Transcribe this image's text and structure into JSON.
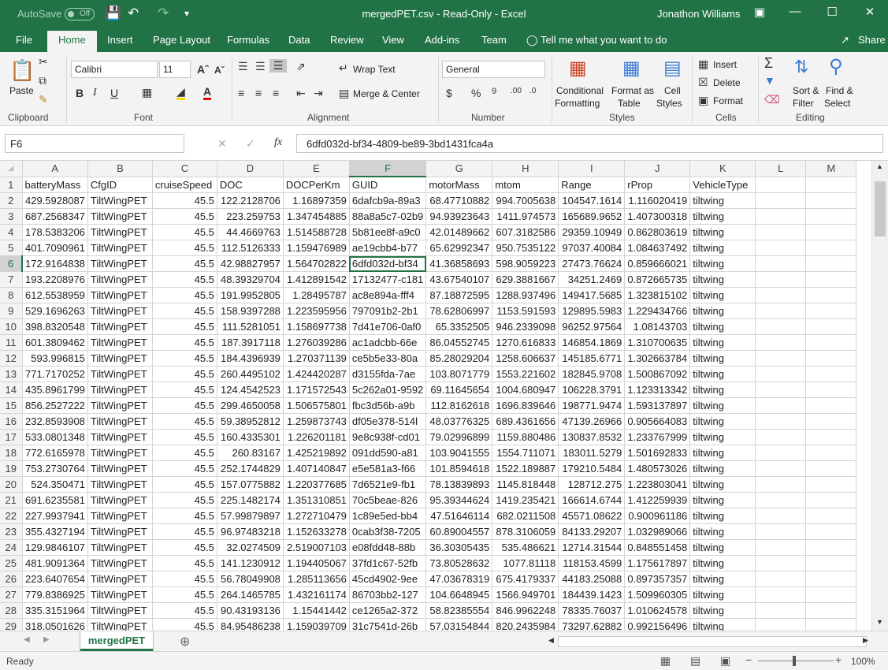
{
  "titlebar": {
    "autosave_label": "AutoSave",
    "autosave_state": "Off",
    "title": "mergedPET.csv  -  Read-Only  -  Excel",
    "user": "Jonathon Williams"
  },
  "tabs": [
    "File",
    "Home",
    "Insert",
    "Page Layout",
    "Formulas",
    "Data",
    "Review",
    "View",
    "Add-ins",
    "Team"
  ],
  "tell_me": "Tell me what you want to do",
  "share": "Share",
  "ribbon": {
    "paste": "Paste",
    "font_name": "Calibri",
    "font_size": "11",
    "wrap_text": "Wrap Text",
    "merge_center": "Merge & Center",
    "number_format": "General",
    "conditional": [
      "Conditional",
      "Formatting"
    ],
    "format_table": [
      "Format as",
      "Table"
    ],
    "cell_styles": [
      "Cell",
      "Styles"
    ],
    "insert": "Insert",
    "delete": "Delete",
    "format": "Format",
    "sort_filter": [
      "Sort &",
      "Filter"
    ],
    "find_select": [
      "Find &",
      "Select"
    ],
    "groups": [
      "Clipboard",
      "Font",
      "Alignment",
      "Number",
      "Styles",
      "Cells",
      "Editing"
    ]
  },
  "formula_bar": {
    "name_box": "F6",
    "formula": "6dfd032d-bf34-4809-be89-3bd1431fca4a"
  },
  "columns": [
    "A",
    "B",
    "C",
    "D",
    "E",
    "F",
    "G",
    "H",
    "I",
    "J",
    "K",
    "L",
    "M"
  ],
  "headers": [
    "batteryMass",
    "CfgID",
    "cruiseSpeed",
    "DOC",
    "DOCPerKm",
    "GUID",
    "motorMass",
    "mtom",
    "Range",
    "rProp",
    "VehicleType"
  ],
  "rows": [
    [
      "429.5928087",
      "TiltWingPET",
      "45.5",
      "122.2128706",
      "1.16897359",
      "6dafcb9a-89a3",
      "68.47710882",
      "994.7005638",
      "104547.1614",
      "1.116020419",
      "tiltwing"
    ],
    [
      "687.2568347",
      "TiltWingPET",
      "45.5",
      "223.259753",
      "1.347454885",
      "88a8a5c7-02b9",
      "94.93923643",
      "1411.974573",
      "165689.9652",
      "1.407300318",
      "tiltwing"
    ],
    [
      "178.5383206",
      "TiltWingPET",
      "45.5",
      "44.4669763",
      "1.514588728",
      "5b81ee8f-a9c0",
      "42.01489662",
      "607.3182586",
      "29359.10949",
      "0.862803619",
      "tiltwing"
    ],
    [
      "401.7090961",
      "TiltWingPET",
      "45.5",
      "112.5126333",
      "1.159476989",
      "ae19cbb4-b77",
      "65.62992347",
      "950.7535122",
      "97037.40084",
      "1.084637492",
      "tiltwing"
    ],
    [
      "172.9164838",
      "TiltWingPET",
      "45.5",
      "42.98827957",
      "1.564702822",
      "6dfd032d-bf34",
      "41.36858693",
      "598.9059223",
      "27473.76624",
      "0.859666021",
      "tiltwing"
    ],
    [
      "193.2208976",
      "TiltWingPET",
      "45.5",
      "48.39329704",
      "1.412891542",
      "17132477-c181",
      "43.67540107",
      "629.3881667",
      "34251.2469",
      "0.872665735",
      "tiltwing"
    ],
    [
      "612.5538959",
      "TiltWingPET",
      "45.5",
      "191.9952805",
      "1.28495787",
      "ac8e894a-fff4",
      "87.18872595",
      "1288.937496",
      "149417.5685",
      "1.323815102",
      "tiltwing"
    ],
    [
      "529.1696263",
      "TiltWingPET",
      "45.5",
      "158.9397288",
      "1.223595956",
      "797091b2-2b1",
      "78.62806997",
      "1153.591593",
      "129895.5983",
      "1.229434766",
      "tiltwing"
    ],
    [
      "398.8320548",
      "TiltWingPET",
      "45.5",
      "111.5281051",
      "1.158697738",
      "7d41e706-0af0",
      "65.3352505",
      "946.2339098",
      "96252.97564",
      "1.08143703",
      "tiltwing"
    ],
    [
      "601.3809462",
      "TiltWingPET",
      "45.5",
      "187.3917118",
      "1.276039286",
      "ac1adcbb-66e",
      "86.04552745",
      "1270.616833",
      "146854.1869",
      "1.310700635",
      "tiltwing"
    ],
    [
      "593.996815",
      "TiltWingPET",
      "45.5",
      "184.4396939",
      "1.270371139",
      "ce5b5e33-80a",
      "85.28029204",
      "1258.606637",
      "145185.6771",
      "1.302663784",
      "tiltwing"
    ],
    [
      "771.7170252",
      "TiltWingPET",
      "45.5",
      "260.4495102",
      "1.424420287",
      "d3155fda-7ae",
      "103.8071779",
      "1553.221602",
      "182845.9708",
      "1.500867092",
      "tiltwing"
    ],
    [
      "435.8961799",
      "TiltWingPET",
      "45.5",
      "124.4542523",
      "1.171572543",
      "5c262a01-9592",
      "69.11645654",
      "1004.680947",
      "106228.3791",
      "1.123313342",
      "tiltwing"
    ],
    [
      "856.2527222",
      "TiltWingPET",
      "45.5",
      "299.4650058",
      "1.506575801",
      "fbc3d56b-a9b",
      "112.8162618",
      "1696.839646",
      "198771.9474",
      "1.593137897",
      "tiltwing"
    ],
    [
      "232.8593908",
      "TiltWingPET",
      "45.5",
      "59.38952812",
      "1.259873743",
      "df05e378-514l",
      "48.03776325",
      "689.4361656",
      "47139.26966",
      "0.905664083",
      "tiltwing"
    ],
    [
      "533.0801348",
      "TiltWingPET",
      "45.5",
      "160.4335301",
      "1.226201181",
      "9e8c938f-cd01",
      "79.02996899",
      "1159.880486",
      "130837.8532",
      "1.233767999",
      "tiltwing"
    ],
    [
      "772.6165978",
      "TiltWingPET",
      "45.5",
      "260.83167",
      "1.425219892",
      "091dd590-a81",
      "103.9041555",
      "1554.711071",
      "183011.5279",
      "1.501692833",
      "tiltwing"
    ],
    [
      "753.2730764",
      "TiltWingPET",
      "45.5",
      "252.1744829",
      "1.407140847",
      "e5e581a3-f66",
      "101.8594618",
      "1522.189887",
      "179210.5484",
      "1.480573026",
      "tiltwing"
    ],
    [
      "524.350471",
      "TiltWingPET",
      "45.5",
      "157.0775882",
      "1.220377685",
      "7d6521e9-fb1",
      "78.13839893",
      "1145.818448",
      "128712.275",
      "1.223803041",
      "tiltwing"
    ],
    [
      "691.6235581",
      "TiltWingPET",
      "45.5",
      "225.1482174",
      "1.351310851",
      "70c5beae-826",
      "95.39344624",
      "1419.235421",
      "166614.6744",
      "1.412259939",
      "tiltwing"
    ],
    [
      "227.9937941",
      "TiltWingPET",
      "45.5",
      "57.99879897",
      "1.272710479",
      "1c89e5ed-bb4",
      "47.51646114",
      "682.0211508",
      "45571.08622",
      "0.900961186",
      "tiltwing"
    ],
    [
      "355.4327194",
      "TiltWingPET",
      "45.5",
      "96.97483218",
      "1.152633278",
      "0cab3f38-7205",
      "60.89004557",
      "878.3106059",
      "84133.29207",
      "1.032989066",
      "tiltwing"
    ],
    [
      "129.9846107",
      "TiltWingPET",
      "45.5",
      "32.0274509",
      "2.519007103",
      "e08fdd48-88b",
      "36.30305435",
      "535.486621",
      "12714.31544",
      "0.848551458",
      "tiltwing"
    ],
    [
      "481.9091364",
      "TiltWingPET",
      "45.5",
      "141.1230912",
      "1.194405067",
      "37fd1c67-52fb",
      "73.80528632",
      "1077.81118",
      "118153.4599",
      "1.175617897",
      "tiltwing"
    ],
    [
      "223.6407654",
      "TiltWingPET",
      "45.5",
      "56.78049908",
      "1.285113656",
      "45cd4902-9ee",
      "47.03678319",
      "675.4179337",
      "44183.25088",
      "0.897357357",
      "tiltwing"
    ],
    [
      "779.8386925",
      "TiltWingPET",
      "45.5",
      "264.1465785",
      "1.432161174",
      "86703bb2-127",
      "104.6648945",
      "1566.949701",
      "184439.1423",
      "1.509960305",
      "tiltwing"
    ],
    [
      "335.3151964",
      "TiltWingPET",
      "45.5",
      "90.43193136",
      "1.15441442",
      "ce1265a2-372",
      "58.82385554",
      "846.9962248",
      "78335.76037",
      "1.010624578",
      "tiltwing"
    ],
    [
      "318.0501626",
      "TiltWingPET",
      "45.5",
      "84.95486238",
      "1.159039709",
      "31c7541d-26b",
      "57.03154844",
      "820.2435984",
      "73297.62882",
      "0.992156496",
      "tiltwing"
    ]
  ],
  "sheet_tab": "mergedPET",
  "status": "Ready",
  "zoom": "100%"
}
